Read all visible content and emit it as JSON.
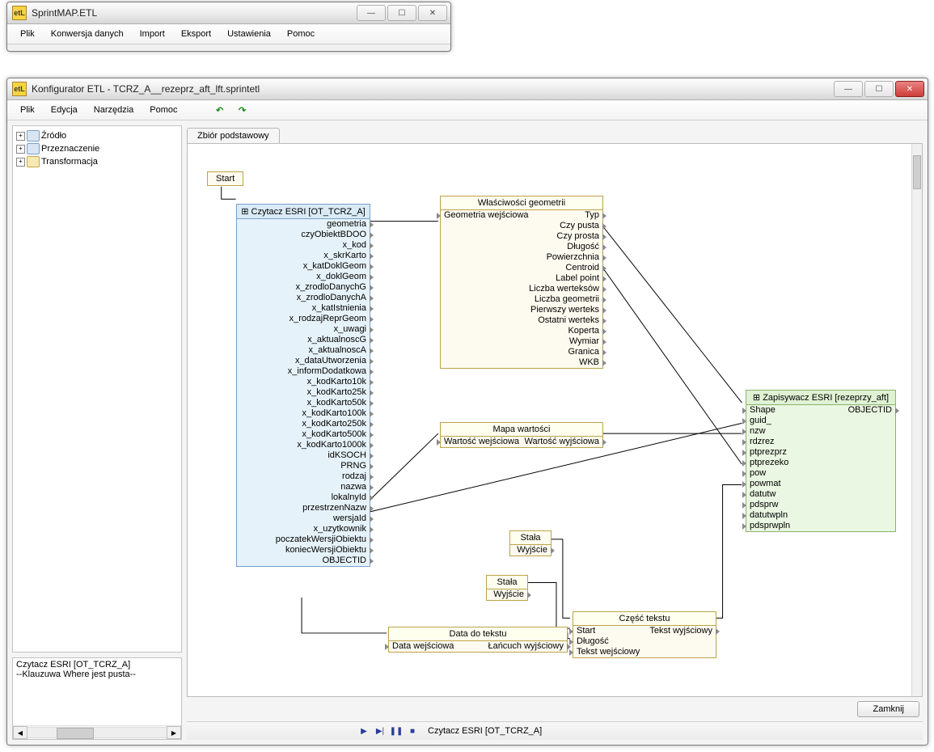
{
  "winA": {
    "title": "SprintMAP.ETL",
    "icon_text": "etL",
    "menus": [
      "Plik",
      "Konwersja danych",
      "Import",
      "Eksport",
      "Ustawienia",
      "Pomoc"
    ]
  },
  "winB": {
    "title": "Konfigurator ETL - TCRZ_A__rezeprz_aft_lft.sprintetl",
    "icon_text": "etL",
    "menus": [
      "Plik",
      "Edycja",
      "Narzędzia",
      "Pomoc"
    ],
    "undo_icon": "↶",
    "redo_icon": "↷",
    "tree": {
      "items": [
        {
          "label": "Źródło",
          "icon": "db"
        },
        {
          "label": "Przeznaczenie",
          "icon": "db"
        },
        {
          "label": "Transformacja",
          "icon": "folder"
        }
      ]
    },
    "tab": "Zbiór podstawowy",
    "start_label": "Start",
    "reader": {
      "title": "Czytacz ESRI [OT_TCRZ_A]",
      "icon": "⊞",
      "fields": [
        "geometria",
        "czyObiektBDOO",
        "x_kod",
        "x_skrKarto",
        "x_katDoklGeom",
        "x_doklGeom",
        "x_zrodloDanychG",
        "x_zrodloDanychA",
        "x_katIstnienia",
        "x_rodzajReprGeom",
        "x_uwagi",
        "x_aktualnoscG",
        "x_aktualnoscA",
        "x_dataUtworzenia",
        "x_informDodatkowa",
        "x_kodKarto10k",
        "x_kodKarto25k",
        "x_kodKarto50k",
        "x_kodKarto100k",
        "x_kodKarto250k",
        "x_kodKarto500k",
        "x_kodKarto1000k",
        "idKSOCH",
        "PRNG",
        "rodzaj",
        "nazwa",
        "lokalnyId",
        "przestrzenNazw",
        "wersjaId",
        "x_uzytkownik",
        "poczatekWersjiObiektu",
        "koniecWersjiObiektu",
        "OBJECTID"
      ]
    },
    "geomprops": {
      "title": "Właściwości geometrii",
      "input": "Geometria wejściowa",
      "outputs": [
        "Typ",
        "Czy pusta",
        "Czy prosta",
        "Długość",
        "Powierzchnia",
        "Centroid",
        "Label point",
        "Liczba werteksów",
        "Liczba geometrii",
        "Pierwszy werteks",
        "Ostatni werteks",
        "Koperta",
        "Wymiar",
        "Granica",
        "WKB"
      ]
    },
    "valmap": {
      "title": "Mapa wartości",
      "input": "Wartość wejściowa",
      "output": "Wartość wyjściowa"
    },
    "const1": {
      "title": "Stała",
      "output": "Wyjście"
    },
    "const2": {
      "title": "Stała",
      "output": "Wyjście"
    },
    "datetotext": {
      "title": "Data do tekstu",
      "input": "Data wejściowa",
      "output": "Łańcuch wyjściowy"
    },
    "textpart": {
      "title": "Część tekstu",
      "inputs": [
        "Start",
        "Długość",
        "Tekst wejściowy"
      ],
      "output": "Tekst wyjściowy"
    },
    "writer": {
      "title": "Zapisywacz ESRI [rezeprzy_aft]",
      "icon": "⊞",
      "right_col": "OBJECTID",
      "fields": [
        "Shape",
        "guid_",
        "nzw",
        "rdzrez",
        "ptprezprz",
        "ptprezeko",
        "pow",
        "powmat",
        "datutw",
        "pdsprw",
        "datutwpln",
        "pdsprwpln"
      ]
    },
    "msgpanel": {
      "line1": "Czytacz ESRI [OT_TCRZ_A]",
      "line2": "--Klauzuwa Where jest pusta--"
    },
    "close_button": "Zamknij",
    "status": {
      "play": "▶",
      "step": "▶|",
      "pause": "❚❚",
      "stop": "■",
      "label": "Czytacz ESRI [OT_TCRZ_A]"
    }
  }
}
